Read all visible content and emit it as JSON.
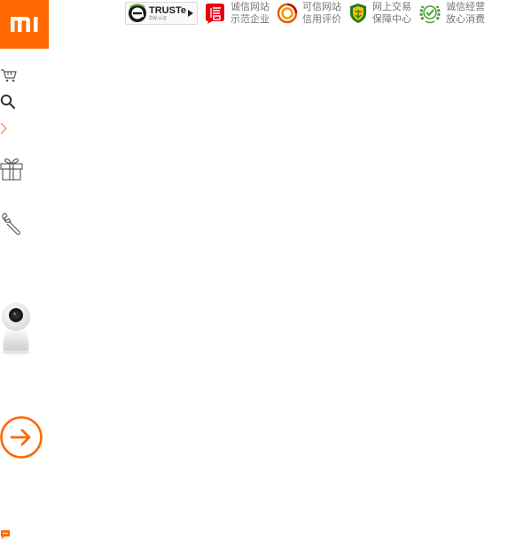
{
  "header": {
    "logo_icon": "mi-logo",
    "brand_color": "#ff6700"
  },
  "trust_badges": {
    "truste": {
      "brand": "TRUSTe",
      "sub": "隐私认证",
      "icon": "truste-e-icon"
    },
    "items": [
      {
        "icon": "xin-seal-icon",
        "line1": "诚信网站",
        "line2": "示范企业",
        "color": "#e60012"
      },
      {
        "icon": "credit-ring-icon",
        "line1": "可信网站",
        "line2": "信用评价",
        "color": "#e85d00"
      },
      {
        "icon": "shield-icon",
        "line1": "网上交易",
        "line2": "保障中心",
        "color": "#1e7b1e"
      },
      {
        "icon": "wreath-icon",
        "line1": "诚信经营",
        "line2": "放心消费",
        "color": "#4aa02c"
      }
    ],
    "text_color": "#757575"
  },
  "sidebar": {
    "icons": [
      "cart-icon",
      "search-icon",
      "chevron-right-icon",
      "gift-icon",
      "wrench-icon",
      "camera-product-image",
      "arrow-right-circle-icon",
      "chat-icon"
    ],
    "accent": "#ff6700"
  }
}
